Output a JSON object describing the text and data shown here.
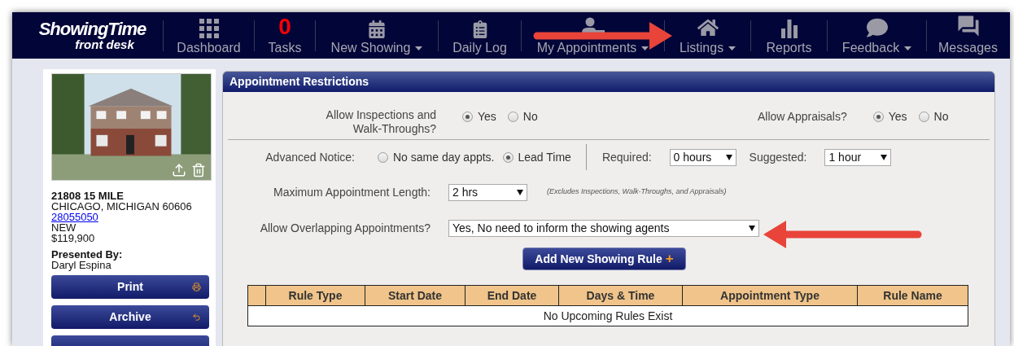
{
  "nav": {
    "logo": {
      "brand": "ShowingTime",
      "tagline": "front desk"
    },
    "items": [
      {
        "kind": "grid",
        "label": "Dashboard",
        "dropdown": false
      },
      {
        "kind": "count",
        "count": "0",
        "label": "Tasks",
        "dropdown": false
      },
      {
        "kind": "calendar",
        "label": "New Showing",
        "dropdown": true
      },
      {
        "kind": "clipboard",
        "label": "Daily Log",
        "dropdown": false
      },
      {
        "kind": "person",
        "label": "My Appointments",
        "dropdown": true
      },
      {
        "kind": "house",
        "label": "Listings",
        "dropdown": true
      },
      {
        "kind": "bars",
        "label": "Reports",
        "dropdown": false
      },
      {
        "kind": "bubble",
        "label": "Feedback",
        "dropdown": true
      },
      {
        "kind": "chats",
        "label": "Messages",
        "dropdown": false
      }
    ]
  },
  "listing": {
    "address": "21808 15 MILE",
    "city": "CHICAGO, MICHIGAN 60606",
    "mls": "28055050",
    "status": "NEW",
    "price": "$119,900",
    "presented_by": "Presented By:",
    "agent": "Daryl Espina",
    "buttons": [
      {
        "label": "Print",
        "kind": "print"
      },
      {
        "label": "Archive",
        "kind": "archive"
      }
    ]
  },
  "panel": {
    "title": "Appointment Restrictions",
    "inspections": {
      "label": "Allow Inspections and Walk-Throughs?",
      "options": [
        {
          "label": "Yes",
          "selected": true
        },
        {
          "label": "No",
          "selected": false
        }
      ]
    },
    "appraisals": {
      "label": "Allow Appraisals?",
      "options": [
        {
          "label": "Yes",
          "selected": true
        },
        {
          "label": "No",
          "selected": false
        }
      ]
    },
    "notice": {
      "label": "Advanced Notice:",
      "options": [
        {
          "label": "No same day appts.",
          "selected": false
        },
        {
          "label": "Lead Time",
          "selected": true
        }
      ]
    },
    "required": {
      "label": "Required:",
      "value": "0 hours"
    },
    "suggested": {
      "label": "Suggested:",
      "value": "1 hour"
    },
    "max_length": {
      "label": "Maximum Appointment Length:",
      "value": "2 hrs",
      "note": "(Excludes Inspections, Walk-Throughs, and Appraisals)"
    },
    "overlap": {
      "label": "Allow Overlapping Appointments?",
      "value": "Yes, No need to inform the showing agents"
    },
    "add_button": {
      "label": "Add New Showing Rule",
      "icon": "+"
    },
    "table": {
      "columns": [
        "Rule Type",
        "Start Date",
        "End Date",
        "Days & Time",
        "Appointment Type",
        "Rule Name"
      ],
      "empty": "No Upcoming Rules Exist"
    }
  }
}
